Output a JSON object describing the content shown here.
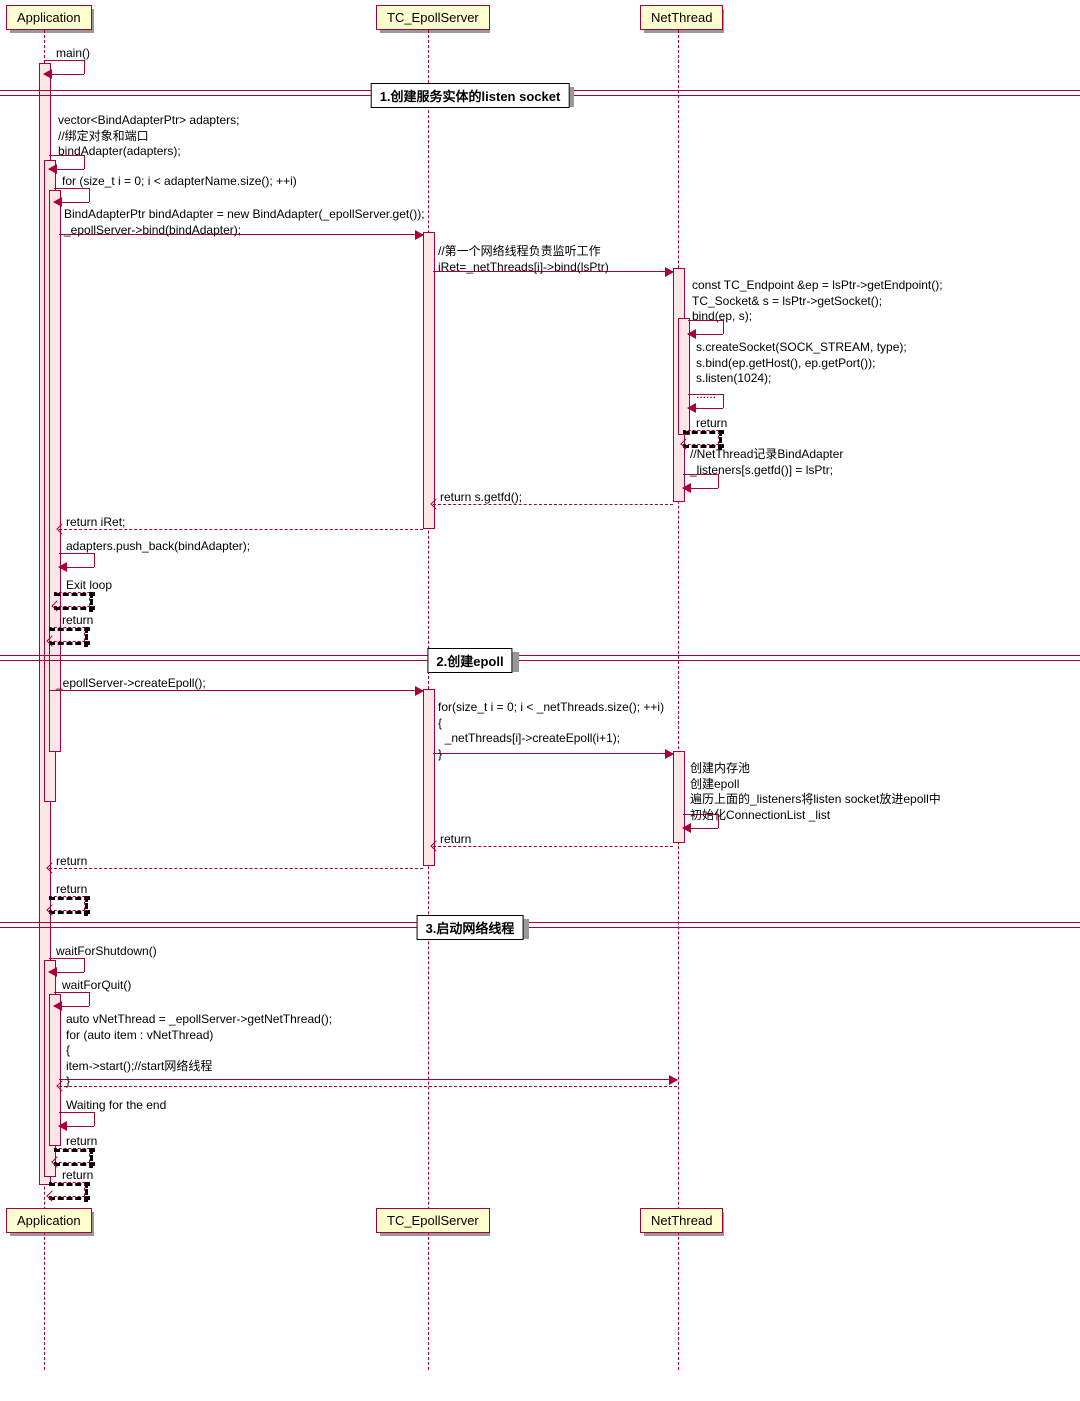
{
  "participants": {
    "app": "Application",
    "epoll": "TC_EpollServer",
    "net": "NetThread"
  },
  "dividers": {
    "d1": "1.创建服务实体的listen socket",
    "d2": "2.创建epoll",
    "d3": "3.启动网络线程"
  },
  "msgs": {
    "m1": "main()",
    "m2": "vector<BindAdapterPtr> adapters;\n//绑定对象和端口\nbindAdapter(adapters);",
    "m3": "for (size_t i = 0; i < adapterName.size(); ++i)",
    "m4": "BindAdapterPtr bindAdapter = new BindAdapter(_epollServer.get());\n_epollServer->bind(bindAdapter);",
    "m5": "//第一个网络线程负责监听工作\niRet=_netThreads[i]->bind(lsPtr)",
    "m6": "const TC_Endpoint &ep = lsPtr->getEndpoint();\nTC_Socket& s = lsPtr->getSocket();\nbind(ep, s);",
    "m7": "s.createSocket(SOCK_STREAM, type);\ns.bind(ep.getHost(), ep.getPort());\ns.listen(1024);\n......",
    "m8": "return",
    "m9": "//NetThread记录BindAdapter\n_listeners[s.getfd()] = lsPtr;",
    "m10": "return s.getfd();",
    "m11": "return iRet;",
    "m12": "adapters.push_back(bindAdapter);",
    "m13": "Exit loop",
    "m14": "return",
    "m15": "_epollServer->createEpoll();",
    "m16": "for(size_t i = 0; i < _netThreads.size(); ++i)\n{\n  _netThreads[i]->createEpoll(i+1);\n}",
    "m17": "创建内存池\n创建epoll\n遍历上面的_listeners将listen socket放进epoll中\n初始化ConnectionList _list",
    "m18": "return",
    "m19": "return",
    "m20": "return",
    "m21": "waitForShutdown()",
    "m22": "waitForQuit()",
    "m23": "auto vNetThread = _epollServer->getNetThread();\nfor (auto item : vNetThread)\n{\nitem->start();//start网络线程\n}",
    "m24": "Waiting for the end",
    "m25": "return",
    "m26": "return"
  }
}
